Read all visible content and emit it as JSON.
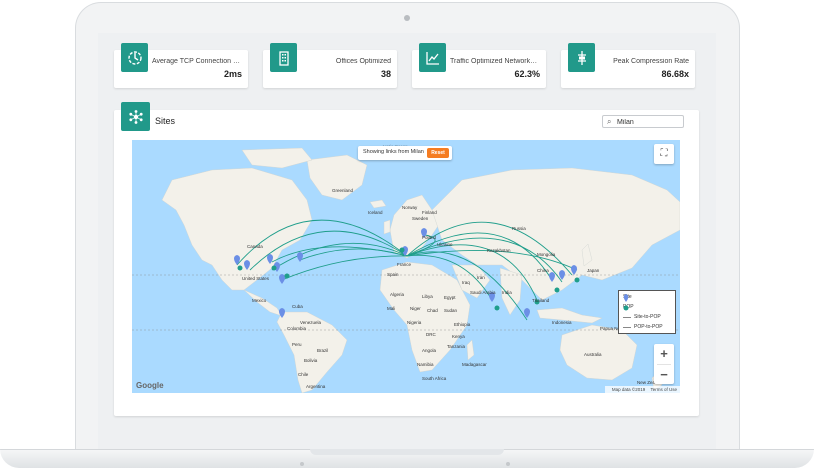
{
  "stats": [
    {
      "label": "Average TCP Connection Set...",
      "value": "2ms",
      "icon": "connection-speed-icon"
    },
    {
      "label": "Offices Optimized",
      "value": "38",
      "icon": "office-building-icon"
    },
    {
      "label": "Traffic Optimized Networkwi...",
      "value": "62.3%",
      "icon": "trend-chart-icon"
    },
    {
      "label": "Peak Compression Rate",
      "value": "86.68x",
      "icon": "compression-icon"
    }
  ],
  "sites": {
    "title": "Sites",
    "icon": "network-hub-icon",
    "search_value": "Milan",
    "banner_text": "Showing links from Milan",
    "reset_label": "Reset"
  },
  "legend": {
    "site": "Site",
    "pop": "POP",
    "site_to_pop": "Site-to-POP",
    "pop_to_pop": "POP-to-POP"
  },
  "map": {
    "google": "Google",
    "map_data": "Map data ©2019",
    "terms": "Terms of Use",
    "zoom_in": "+",
    "zoom_out": "−",
    "colors": {
      "water": "#aadaff",
      "land": "#f3f1ea",
      "arc": "#1f9e8b",
      "site_pin": "#6b8fe6",
      "pop_pin": "#1f9e8b"
    },
    "labels": [
      {
        "text": "Greenland"
      },
      {
        "text": "Canada"
      },
      {
        "text": "United States"
      },
      {
        "text": "Mexico"
      },
      {
        "text": "Cuba"
      },
      {
        "text": "Venezuela"
      },
      {
        "text": "Colombia"
      },
      {
        "text": "Peru"
      },
      {
        "text": "Brazil"
      },
      {
        "text": "Bolivia"
      },
      {
        "text": "Chile"
      },
      {
        "text": "Argentina"
      },
      {
        "text": "Iceland"
      },
      {
        "text": "Norway"
      },
      {
        "text": "Sweden"
      },
      {
        "text": "Finland"
      },
      {
        "text": "Poland"
      },
      {
        "text": "Ukraine"
      },
      {
        "text": "France"
      },
      {
        "text": "Spain"
      },
      {
        "text": "Russia"
      },
      {
        "text": "Kazakhstan"
      },
      {
        "text": "Mongolia"
      },
      {
        "text": "China"
      },
      {
        "text": "Iran"
      },
      {
        "text": "Iraq"
      },
      {
        "text": "Algeria"
      },
      {
        "text": "Libya"
      },
      {
        "text": "Egypt"
      },
      {
        "text": "Mali"
      },
      {
        "text": "Niger"
      },
      {
        "text": "Chad"
      },
      {
        "text": "Sudan"
      },
      {
        "text": "Nigeria"
      },
      {
        "text": "Ethiopia"
      },
      {
        "text": "DRC"
      },
      {
        "text": "Kenya"
      },
      {
        "text": "Tanzania"
      },
      {
        "text": "Angola"
      },
      {
        "text": "Namibia"
      },
      {
        "text": "South Africa"
      },
      {
        "text": "Madagascar"
      },
      {
        "text": "Saudi Arabia"
      },
      {
        "text": "India"
      },
      {
        "text": "Thailand"
      },
      {
        "text": "Indonesia"
      },
      {
        "text": "Papua New Guinea"
      },
      {
        "text": "Australia"
      },
      {
        "text": "New Zealand"
      },
      {
        "text": "Japan"
      },
      {
        "text": "Arctic Ocean"
      }
    ]
  }
}
